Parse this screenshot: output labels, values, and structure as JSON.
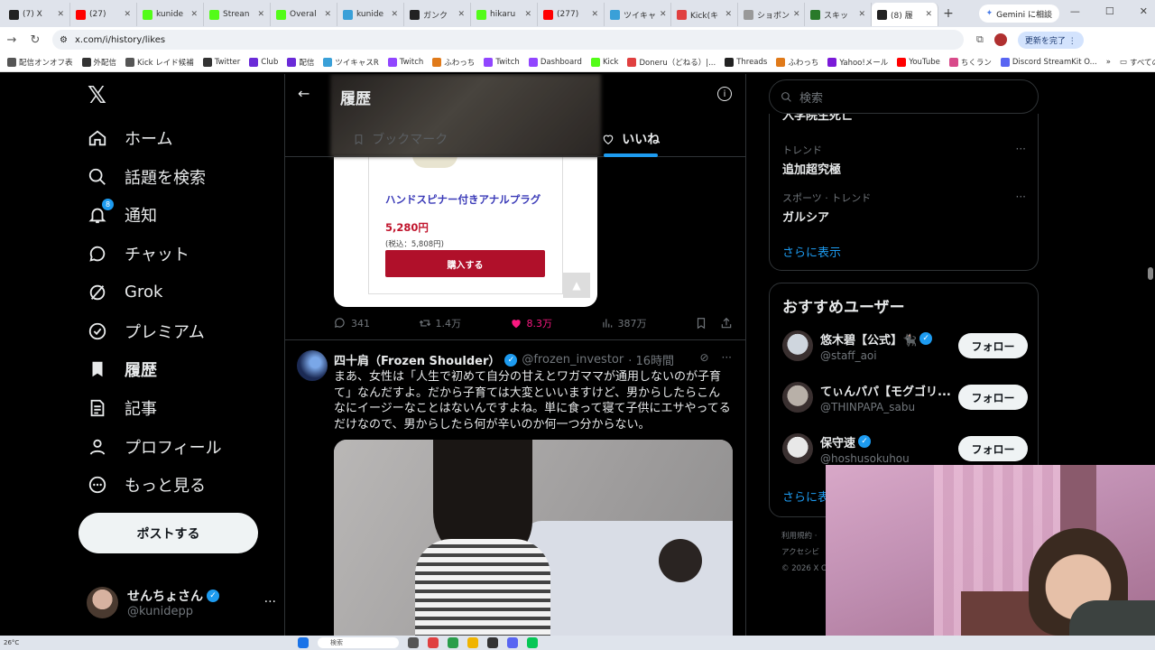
{
  "browser": {
    "tabs": [
      {
        "label": "(7) X",
        "color": "#222222",
        "active": false
      },
      {
        "label": "(27)",
        "color": "#ff0000",
        "active": false
      },
      {
        "label": "kunide",
        "color": "#53fc18",
        "active": false
      },
      {
        "label": "Strean",
        "color": "#53fc18",
        "active": false
      },
      {
        "label": "Overal",
        "color": "#53fc18",
        "active": false
      },
      {
        "label": "kunide",
        "color": "#3aa0d8",
        "active": false
      },
      {
        "label": "ガンク",
        "color": "#222222",
        "active": false
      },
      {
        "label": "hikaru",
        "color": "#53fc18",
        "active": false
      },
      {
        "label": "(277)",
        "color": "#ff0000",
        "active": false
      },
      {
        "label": "ツイキャ",
        "color": "#3aa0d8",
        "active": false
      },
      {
        "label": "Kick(キ",
        "color": "#e04040",
        "active": false
      },
      {
        "label": "ショボン",
        "color": "#999999",
        "active": false
      },
      {
        "label": "スキッ",
        "color": "#2a7a2a",
        "active": false
      },
      {
        "label": "(8) 履",
        "color": "#222222",
        "active": true
      }
    ],
    "gemini_label": "Gemini に相談",
    "url": "x.com/i/history/likes",
    "update_label": "更新を完了 ⋮",
    "bookmarks": [
      {
        "label": "配信オンオフ表",
        "color": "#555555"
      },
      {
        "label": "外配信",
        "color": "#333333"
      },
      {
        "label": "Kick レイド候補",
        "color": "#555555"
      },
      {
        "label": "Twitter",
        "color": "#333333"
      },
      {
        "label": "Club",
        "color": "#6a2bd8"
      },
      {
        "label": "配信",
        "color": "#6a2bd8"
      },
      {
        "label": "ツイキャスR",
        "color": "#3aa0d8"
      },
      {
        "label": "Twitch",
        "color": "#9146ff"
      },
      {
        "label": "ふわっち",
        "color": "#e07a1a"
      },
      {
        "label": "Twitch",
        "color": "#9146ff"
      },
      {
        "label": "Dashboard",
        "color": "#9146ff"
      },
      {
        "label": "Kick",
        "color": "#53fc18"
      },
      {
        "label": "Doneru（どねる）|...",
        "color": "#e04040"
      },
      {
        "label": "Threads",
        "color": "#222222"
      },
      {
        "label": "ふわっち",
        "color": "#e07a1a"
      },
      {
        "label": "Yahoo!メール",
        "color": "#7a1ad8"
      },
      {
        "label": "YouTube",
        "color": "#ff0000"
      },
      {
        "label": "ちくラン",
        "color": "#d84a8a"
      },
      {
        "label": "Discord StreamKit O...",
        "color": "#5865f2"
      }
    ],
    "all_bookmarks_label": "すべてのブックマーク"
  },
  "nav": {
    "items": [
      {
        "label": "ホーム",
        "icon": "home-icon"
      },
      {
        "label": "話題を検索",
        "icon": "search-icon"
      },
      {
        "label": "通知",
        "icon": "bell-icon",
        "badge": "8"
      },
      {
        "label": "チャット",
        "icon": "chat-icon"
      },
      {
        "label": "Grok",
        "icon": "grok-icon"
      },
      {
        "label": "プレミアム",
        "icon": "premium-icon"
      },
      {
        "label": "履歴",
        "icon": "bookmark-icon",
        "active": true
      },
      {
        "label": "記事",
        "icon": "article-icon"
      },
      {
        "label": "プロフィール",
        "icon": "person-icon"
      },
      {
        "label": "もっと見る",
        "icon": "more-circle-icon"
      }
    ],
    "post_label": "ポストする",
    "account": {
      "name": "せんちょさん",
      "handle": "@kunidepp",
      "more": "···"
    }
  },
  "header": {
    "title": "履歴",
    "tabs": [
      {
        "label": "ブックマーク",
        "selected": false
      },
      {
        "label": "いいね",
        "selected": true
      }
    ]
  },
  "product": {
    "name": "ハンドスピナー付きアナルプラグ",
    "price": "5,280円",
    "tax": "(税込：5,808円)",
    "buy_label": "購入する",
    "up_label": "▲"
  },
  "tweet1_actions": {
    "replies": "341",
    "retweets": "1.4万",
    "likes": "8.3万",
    "views": "387万"
  },
  "tweet2": {
    "name": "四十肩（Frozen Shoulder）",
    "handle": "@frozen_investor",
    "time": "· 16時間",
    "text": "まあ、女性は「人生で初めて自分の甘えとワガママが通用しないのが子育て」なんだすよ。だから子育ては大変といいますけど、男からしたらこんなにイージーなことはないんですよね。単に食って寝て子供にエサやってるだけなので、男からしたら何が辛いのか何一つ分からない。",
    "more": "···"
  },
  "right": {
    "search_placeholder": "検索",
    "trend_cut": "入学院生死亡",
    "trends": [
      {
        "category": "トレンド",
        "name": "追加超究極"
      },
      {
        "category": "スポーツ · トレンド",
        "name": "ガルシア"
      }
    ],
    "trend_more": "···",
    "show_more": "さらに表示",
    "users_title": "おすすめユーザー",
    "users": [
      {
        "name": "悠木碧【公式】🐈‍⬛",
        "handle": "@staff_aoi",
        "follow": "フォロー",
        "color": "#cfd6de"
      },
      {
        "name": "てぃんパパ【モグゴリ...",
        "handle": "@THINPAPA_sabu",
        "follow": "フォロー",
        "color": "#b8b0a8"
      },
      {
        "name": "保守速",
        "handle": "@hoshusokuhou",
        "follow": "フォロー",
        "color": "#e8e8e8"
      }
    ],
    "users_more": "さらに表",
    "footer": [
      "利用規約 ·",
      "アクセシビ",
      "© 2026 X C"
    ]
  },
  "taskbar": {
    "temp": "26°C",
    "search": "検索"
  }
}
